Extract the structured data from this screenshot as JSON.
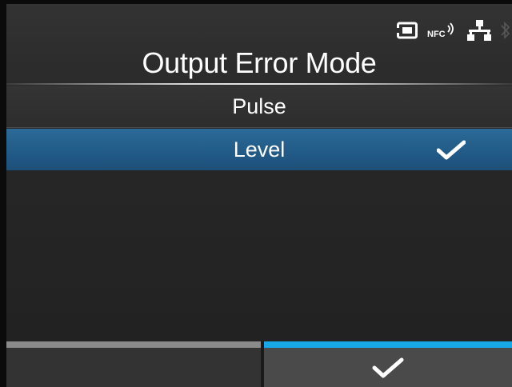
{
  "screen": {
    "title": "Output Error Mode"
  },
  "status_icons": [
    "sd-card-icon",
    "nfc-icon",
    "network-icon",
    "bluetooth-icon"
  ],
  "status": {
    "nfc_label": "NFC"
  },
  "options": [
    {
      "label": "Pulse",
      "selected": false
    },
    {
      "label": "Level",
      "selected": true
    }
  ],
  "footer": {
    "left_button": "",
    "right_button_icon": "checkmark-icon"
  },
  "colors": {
    "selection": "#215a86",
    "confirm_accent": "#19a8e6",
    "text": "#ffffff"
  }
}
